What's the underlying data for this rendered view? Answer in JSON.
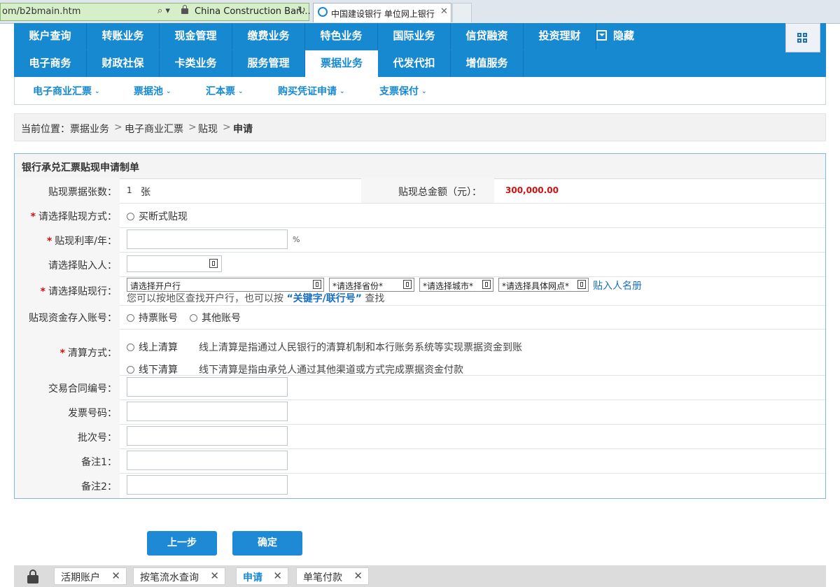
{
  "browser": {
    "url": "om/b2bmain.htm",
    "site": "China Construction Ban...",
    "tab_title": "中国建设银行 单位网上银行"
  },
  "nav": {
    "row1": [
      "账户查询",
      "转账业务",
      "现金管理",
      "缴费业务",
      "特色业务",
      "国际业务",
      "信贷融资",
      "投资理财"
    ],
    "row2": [
      "电子商务",
      "财政社保",
      "卡类业务",
      "服务管理",
      "票据业务",
      "代发代扣",
      "增值服务"
    ],
    "active": "票据业务",
    "hide_label": "隐藏"
  },
  "subnav": [
    "电子商业汇票",
    "票据池",
    "汇本票",
    "购买凭证申请",
    "支票保付"
  ],
  "breadcrumb": {
    "prefix": "当前位置：",
    "items": [
      "票据业务",
      "电子商业汇票",
      "贴现"
    ],
    "current": "申请",
    "sep": ">"
  },
  "form": {
    "title": "银行承兑汇票贴现申请制单",
    "count_label": "贴现票据张数：",
    "count_value": "1",
    "count_unit": "张",
    "total_label": "贴现总金额（元）：",
    "total_value": "300,000.00",
    "method_label": "请选择贴现方式：",
    "method_option": "买断式贴现",
    "rate_label": "贴现利率/年：",
    "rate_unit": "%",
    "discounter_label": "请选择贴入人：",
    "bank_label": "请选择贴现行：",
    "bank_select": "请选择开户行",
    "province_select": "*请选择省份*",
    "city_select": "*请选择城市*",
    "branch_select": "*请选择具体网点*",
    "discounter_list_link": "贴入人名册",
    "search_hint_pre": "您可以按地区查找开户行，也可以按",
    "search_hint_keyword": "“关键字/联行号”",
    "search_hint_post": "查找",
    "account_label": "贴现资金存入账号：",
    "account_opt1": "持票账号",
    "account_opt2": "其他账号",
    "settle_label": "清算方式：",
    "settle_opt1": "线上清算",
    "settle_desc1": "线上清算是指通过人民银行的清算机制和本行账务系统等实现票据资金到账",
    "settle_opt2": "线下清算",
    "settle_desc2": "线下清算是指由承兑人通过其他渠道或方式完成票据资金付款",
    "contract_label": "交易合同编号：",
    "invoice_label": "发票号码：",
    "batch_label": "批次号：",
    "note1_label": "备注1：",
    "note2_label": "备注2："
  },
  "buttons": {
    "prev": "上一步",
    "confirm": "确定"
  },
  "taskbar": [
    "活期账户",
    "按笔流水查询",
    "申请",
    "单笔付款"
  ],
  "taskbar_active": "申请",
  "colors": {
    "nav_blue": "#1689d1",
    "amount_red": "#d01010"
  }
}
